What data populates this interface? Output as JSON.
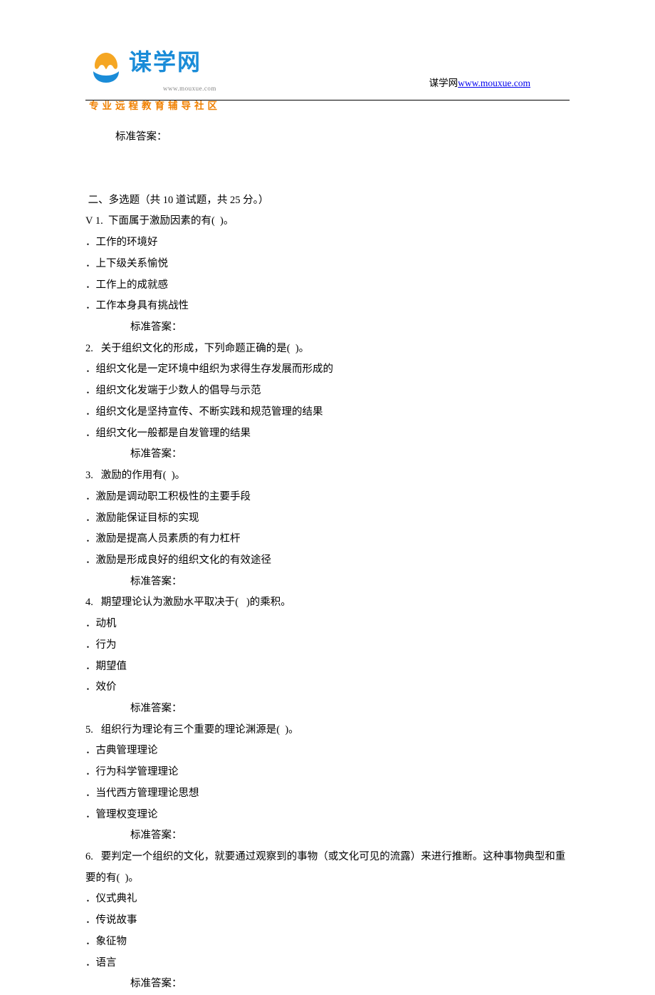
{
  "header": {
    "brand_name": "谋学网",
    "brand_url": "www.mouxue.com",
    "subtitle": "专业远程教育辅导社区",
    "right_site_name": "谋学网",
    "right_site_link": "www.mouxue.com"
  },
  "intro": {
    "standard_answer_top": "标准答案：",
    "section_heading": " 二、多选题（共 10 道试题，共 25 分。）"
  },
  "questions": [
    {
      "stem": "V 1.  下面属于激励因素的有(  )。",
      "options": [
        "．工作的环境好",
        "．上下级关系愉悦",
        "．工作上的成就感",
        "．工作本身具有挑战性"
      ],
      "answer_label": "标准答案："
    },
    {
      "stem": "2.   关于组织文化的形成，下列命题正确的是(  )。",
      "options": [
        "．组织文化是一定环境中组织为求得生存发展而形成的",
        "．组织文化发端于少数人的倡导与示范",
        "．组织文化是坚持宣传、不断实践和规范管理的结果",
        "．组织文化一般都是自发管理的结果"
      ],
      "answer_label": "标准答案："
    },
    {
      "stem": "3.   激励的作用有(  )。",
      "options": [
        "．激励是调动职工积极性的主要手段",
        "．激励能保证目标的实现",
        "．激励是提高人员素质的有力杠杆",
        "．激励是形成良好的组织文化的有效途径"
      ],
      "answer_label": "标准答案："
    },
    {
      "stem": "4.   期望理论认为激励水平取决于(   )的乘积。",
      "options": [
        "．动机",
        "．行为",
        "．期望值",
        "．效价"
      ],
      "answer_label": "标准答案："
    },
    {
      "stem": "5.   组织行为理论有三个重要的理论渊源是(  )。",
      "options": [
        "．古典管理理论",
        "．行为科学管理理论",
        "．当代西方管理理论思想",
        "．管理权变理论"
      ],
      "answer_label": "标准答案："
    },
    {
      "stem": "6.   要判定一个组织的文化，就要通过观察到的事物（或文化可见的流露）来进行推断。这种事物典型和重要的有(  )。",
      "options": [
        "．仪式典礼",
        "．传说故事",
        "．象征物",
        "．语言"
      ],
      "answer_label": "标准答案："
    }
  ]
}
